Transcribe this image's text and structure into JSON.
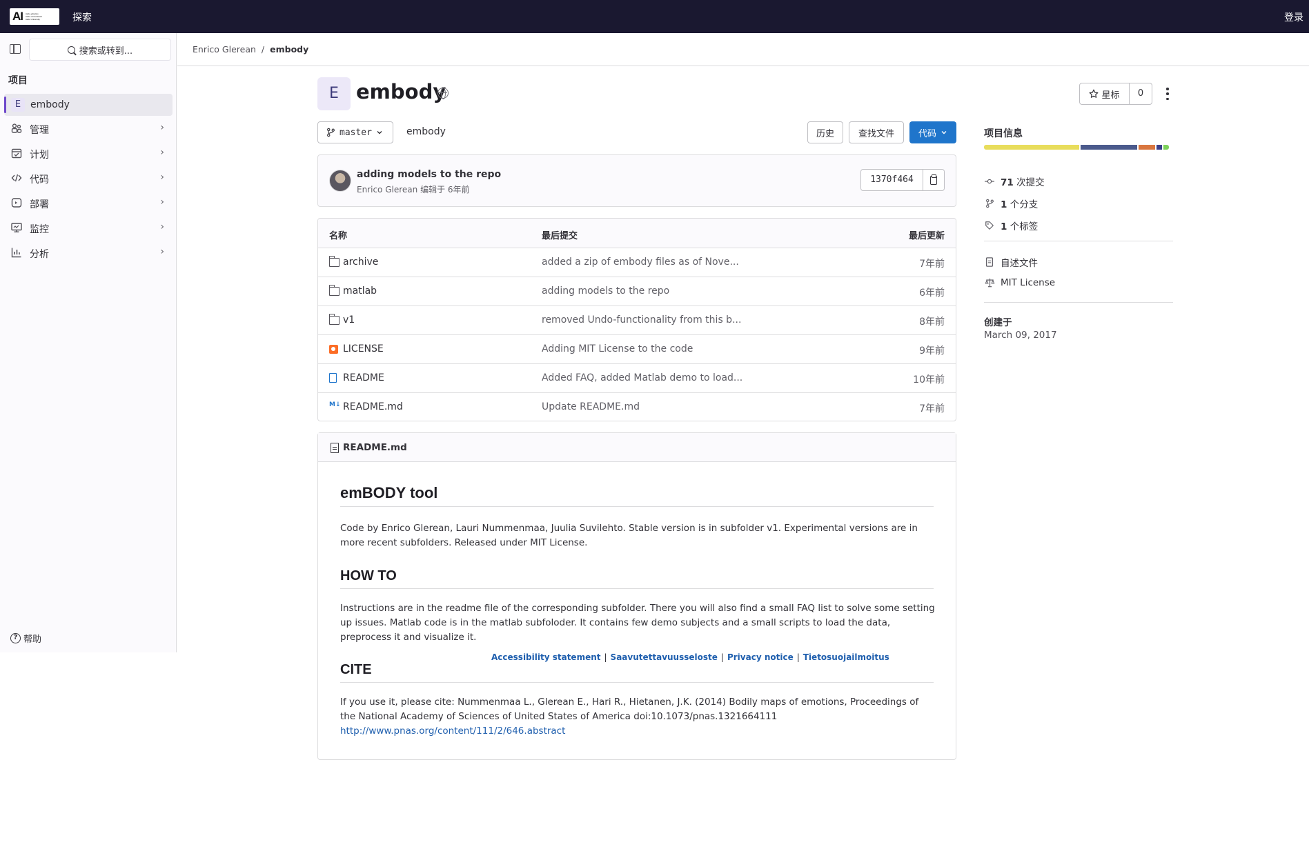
{
  "topbar": {
    "logo_text": "AI",
    "logo_sub": [
      "Aalto-yliopisto",
      "Aalto-universitetet",
      "Aalto University"
    ],
    "explore": "探索",
    "login": "登录"
  },
  "sidebar": {
    "search_placeholder": "搜索或转到...",
    "section_label": "项目",
    "project": {
      "avatar": "E",
      "name": "embody"
    },
    "items": [
      {
        "label": "管理",
        "icon": "users-icon"
      },
      {
        "label": "计划",
        "icon": "calendar-icon"
      },
      {
        "label": "代码",
        "icon": "code-icon"
      },
      {
        "label": "部署",
        "icon": "rocket-icon"
      },
      {
        "label": "监控",
        "icon": "monitor-icon"
      },
      {
        "label": "分析",
        "icon": "chart-icon"
      }
    ],
    "help": "帮助"
  },
  "breadcrumb": {
    "owner": "Enrico Glerean",
    "separator": "/",
    "project": "embody"
  },
  "project": {
    "avatar": "E",
    "title": "embody",
    "star_label": "星标",
    "star_count": "0"
  },
  "toolbar": {
    "branch": "master",
    "path": "embody",
    "history": "历史",
    "find_file": "查找文件",
    "code": "代码"
  },
  "commit": {
    "message": "adding models to the repo",
    "author": "Enrico Glerean",
    "meta_suffix": "编辑于 6年前",
    "sha": "1370f464"
  },
  "files": {
    "headers": {
      "name": "名称",
      "last_commit": "最后提交",
      "last_update": "最后更新"
    },
    "rows": [
      {
        "name": "archive",
        "type": "folder",
        "commit": "added a zip of embody files as of Nove...",
        "date": "7年前"
      },
      {
        "name": "matlab",
        "type": "folder",
        "commit": "adding models to the repo",
        "date": "6年前"
      },
      {
        "name": "v1",
        "type": "folder",
        "commit": "removed Undo-functionality from this b...",
        "date": "8年前"
      },
      {
        "name": "LICENSE",
        "type": "license",
        "commit": "Adding MIT License to the code",
        "date": "9年前"
      },
      {
        "name": "README",
        "type": "doc",
        "commit": "Added FAQ, added Matlab demo to load...",
        "date": "10年前"
      },
      {
        "name": "README.md",
        "type": "markdown",
        "commit": "Update README.md",
        "date": "7年前"
      }
    ]
  },
  "readme": {
    "filename": "README.md",
    "h1": "emBODY tool",
    "p1": "Code by Enrico Glerean, Lauri Nummenmaa, Juulia Suvilehto. Stable version is in subfolder v1. Experimental versions are in more recent subfolders. Released under MIT License.",
    "h2_howto": "HOW TO",
    "p2": "Instructions are in the readme file of the corresponding subfolder. There you will also find a small FAQ list to solve some setting up issues. Matlab code is in the matlab subfoloder. It contains few demo subjects and a small scripts to load the data, preprocess it and visualize it.",
    "h2_cite": "CITE",
    "p3": "If you use it, please cite: Nummenmaa L., Glerean E., Hari R., Hietanen, J.K. (2014) Bodily maps of emotions, Proceedings of the National Academy of Sciences of United States of America doi:10.1073/pnas.1321664111",
    "link": "http://www.pnas.org/content/111/2/646.abstract"
  },
  "footer": {
    "links": [
      "Accessibility statement",
      "Saavutettavuusseloste",
      "Privacy notice",
      "Tietosuojailmoitus"
    ],
    "separator": "|"
  },
  "project_info": {
    "title": "项目信息",
    "languages": [
      {
        "color": "#e8dd5c",
        "share": 0.52
      },
      {
        "color": "#4b5a8c",
        "share": 0.31
      },
      {
        "color": "#d9763f",
        "share": 0.09
      },
      {
        "color": "#3b3f8a",
        "share": 0.03
      },
      {
        "color": "#7dd15a",
        "share": 0.03
      }
    ],
    "commits_count": "71",
    "commits_label": "次提交",
    "branches_count": "1",
    "branches_label": "个分支",
    "tags_count": "1",
    "tags_label": "个标签",
    "readme": "自述文件",
    "license": "MIT License",
    "created_label": "创建于",
    "created_date": "March 09, 2017"
  }
}
